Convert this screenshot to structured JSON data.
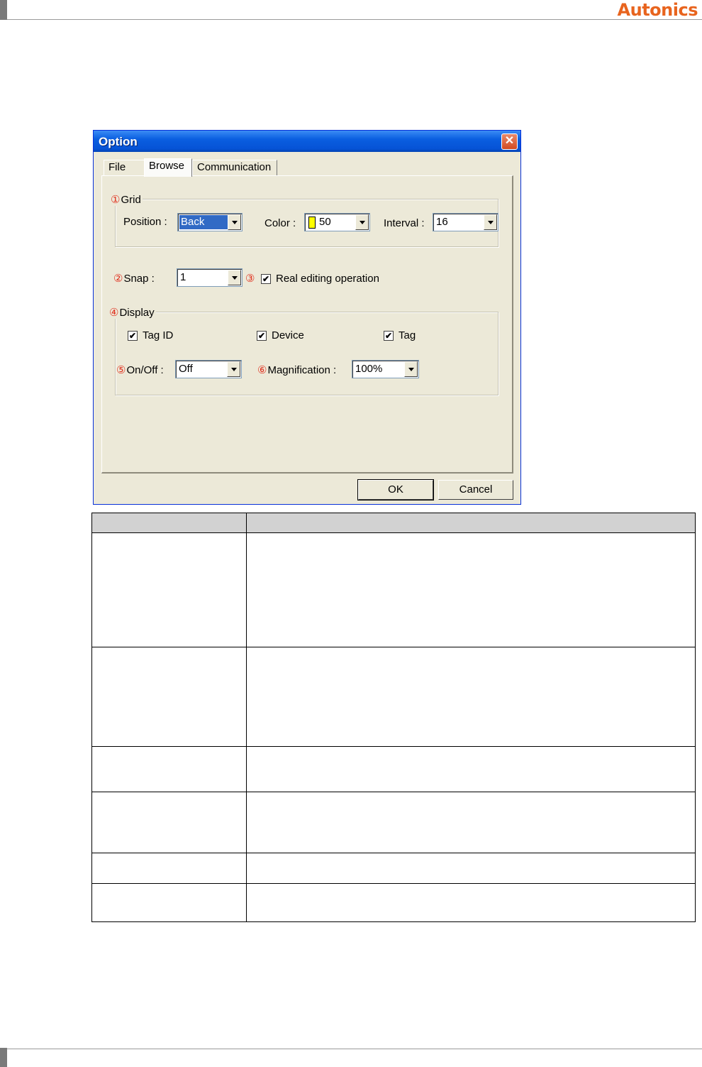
{
  "page": {
    "logo": "Autonics"
  },
  "dialog": {
    "title": "Option",
    "close_glyph": "✕",
    "tabs": [
      {
        "label": "File"
      },
      {
        "label": "Browse"
      },
      {
        "label": "Communication"
      }
    ],
    "active_tab": "Browse",
    "grid": {
      "number": "①",
      "label": "Grid",
      "position_label": "Position :",
      "position_value": "Back",
      "color_label": "Color :",
      "color_value": "50",
      "color_swatch": "#ffff00",
      "interval_label": "Interval :",
      "interval_value": "16"
    },
    "snap": {
      "number": "②",
      "label": "Snap :",
      "value": "1"
    },
    "real_editing": {
      "number": "③",
      "label": "Real editing operation",
      "checked": true
    },
    "display": {
      "number": "④",
      "label": "Display",
      "tag_id_label": "Tag ID",
      "device_label": "Device",
      "tag_label": "Tag",
      "check_glyph": "✔",
      "onoff_number": "⑤",
      "onoff_label": "On/Off :",
      "onoff_value": "Off",
      "magnification_number": "⑥",
      "magnification_label": "Magnification :",
      "magnification_value": "100%"
    },
    "ok_label": "OK",
    "cancel_label": "Cancel"
  },
  "colors": {
    "accent_orange": "#e8641e",
    "title_blue": "#0653d6",
    "number_red": "#e0301e"
  }
}
